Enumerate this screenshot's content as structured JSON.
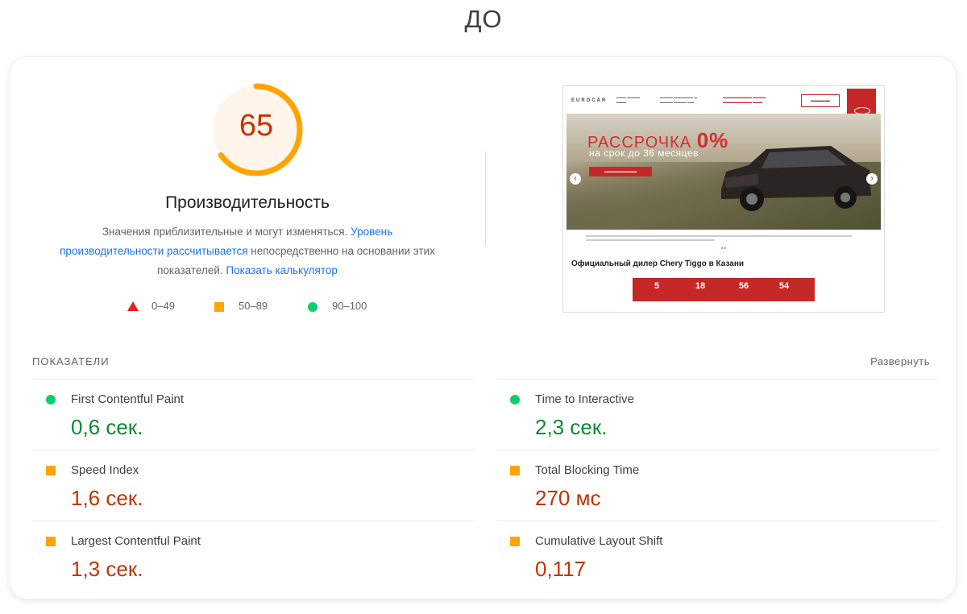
{
  "header": {
    "title": "ДО"
  },
  "performance": {
    "score": "65",
    "score_fraction": 0.65,
    "title": "Производительность",
    "desc_1": "Значения приблизительные и могут изменяться. ",
    "desc_link_1": "Уровень производительности рассчитывается",
    "desc_2": " непосредственно на основании этих показателей. ",
    "desc_link_2": "Показать калькулятор",
    "legend": [
      {
        "icon": "red-triangle-icon",
        "label": "0–49"
      },
      {
        "icon": "orange-square-icon",
        "label": "50–89"
      },
      {
        "icon": "green-circle-icon",
        "label": "90–100"
      }
    ]
  },
  "screenshot": {
    "site_logo": "EUROCAR",
    "promo_line1": "РАССРОЧКА ",
    "promo_big": "0%",
    "promo_line2": "на срок до 36 месяцев",
    "heading": "Официальный дилер Chery Tiggo в Казани",
    "countdown": [
      "5",
      "18",
      "56",
      "54"
    ],
    "arrow_left": "‹",
    "arrow_right": "›"
  },
  "metrics": {
    "section_label": "ПОКАЗАТЕЛИ",
    "expand_label": "Развернуть",
    "items": [
      {
        "name": "First Contentful Paint",
        "value": "0,6 сек.",
        "status": "good",
        "icon": "green-circle-icon"
      },
      {
        "name": "Time to Interactive",
        "value": "2,3 сек.",
        "status": "good",
        "icon": "green-circle-icon"
      },
      {
        "name": "Speed Index",
        "value": "1,6 сек.",
        "status": "average",
        "icon": "orange-square-icon"
      },
      {
        "name": "Total Blocking Time",
        "value": "270 мс",
        "status": "average",
        "icon": "orange-square-icon"
      },
      {
        "name": "Largest Contentful Paint",
        "value": "1,3 сек.",
        "status": "average",
        "icon": "orange-square-icon"
      },
      {
        "name": "Cumulative Layout Shift",
        "value": "0,117",
        "status": "average",
        "icon": "orange-square-icon"
      }
    ]
  },
  "colors": {
    "good": "#0cce6b",
    "average": "#ffa400",
    "poor": "#e8211b",
    "score_text": "#c33300",
    "link": "#1a73e8"
  }
}
